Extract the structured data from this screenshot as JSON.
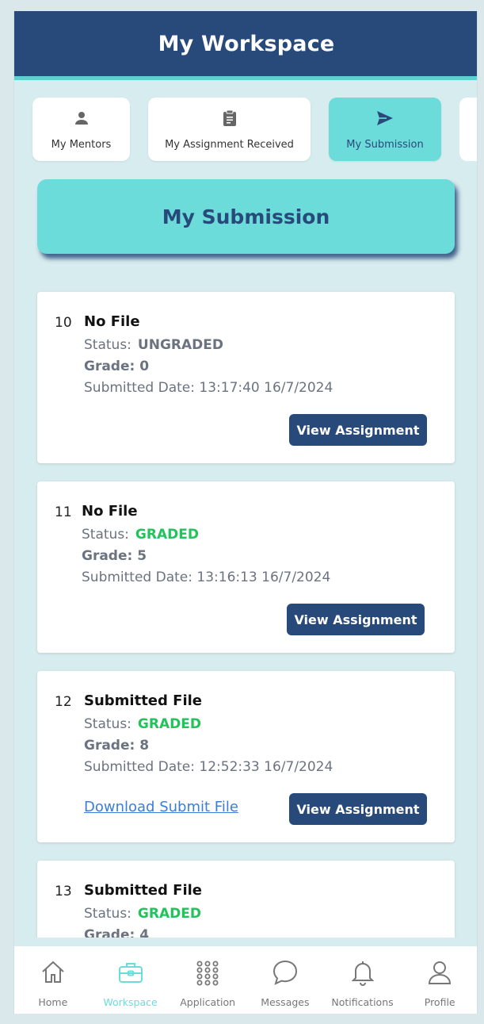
{
  "header": {
    "title": "My Workspace"
  },
  "tabs": [
    {
      "label": "My Mentors",
      "icon": "person-icon"
    },
    {
      "label": "My Assignment Received",
      "icon": "clipboard-icon"
    },
    {
      "label": "My Submission",
      "icon": "send-icon",
      "active": true
    }
  ],
  "section": {
    "title": "My Submission"
  },
  "submissions": [
    {
      "index": "10",
      "title": "No File",
      "status_label": "Status:",
      "status": "UNGRADED",
      "grade": "Grade: 0",
      "date": "Submitted Date: 13:17:40 16/7/2024",
      "view_label": "View Assignment"
    },
    {
      "index": "11",
      "title": "No File",
      "status_label": "Status:",
      "status": "GRADED",
      "grade": "Grade: 5",
      "date": "Submitted Date: 13:16:13 16/7/2024",
      "view_label": "View Assignment"
    },
    {
      "index": "12",
      "title": "Submitted File",
      "status_label": "Status:",
      "status": "GRADED",
      "grade": "Grade: 8",
      "date": "Submitted Date: 12:52:33 16/7/2024",
      "download_label": "Download Submit File",
      "view_label": "View Assignment"
    },
    {
      "index": "13",
      "title": "Submitted File",
      "status_label": "Status:",
      "status": "GRADED",
      "grade": "Grade: 4"
    }
  ],
  "nav": [
    {
      "label": "Home",
      "icon": "home-icon"
    },
    {
      "label": "Workspace",
      "icon": "briefcase-icon",
      "active": true
    },
    {
      "label": "Application",
      "icon": "grid-icon"
    },
    {
      "label": "Messages",
      "icon": "chat-icon"
    },
    {
      "label": "Notifications",
      "icon": "bell-icon"
    },
    {
      "label": "Profile",
      "icon": "user-icon"
    }
  ],
  "colors": {
    "primary": "#284a7a",
    "accent": "#6bdcda",
    "graded": "#22c25c",
    "link": "#3b7dd8",
    "background": "#d7ecee"
  }
}
